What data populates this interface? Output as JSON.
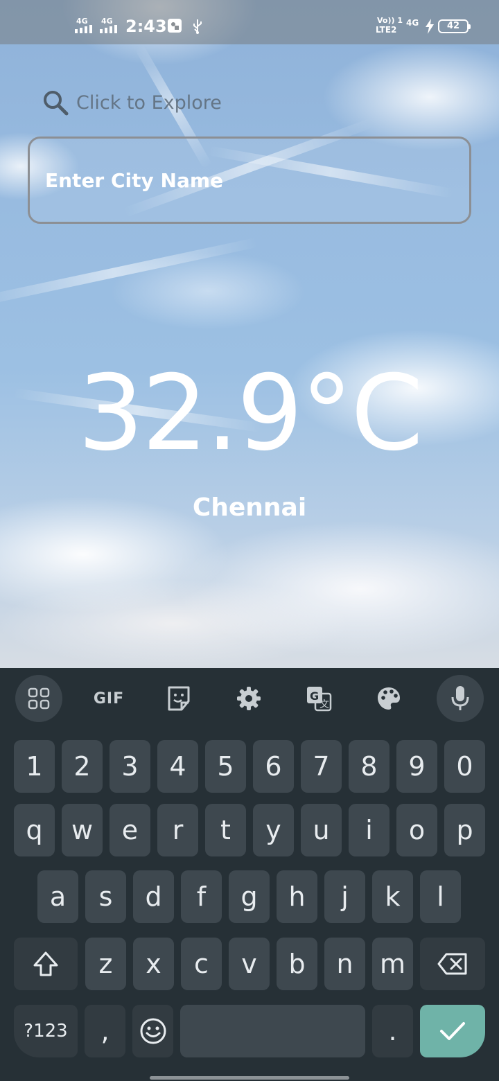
{
  "status_bar": {
    "signal1": "4G",
    "signal2": "4G",
    "time": "2:43",
    "volte": "Vo)) 1",
    "lte": "LTE2",
    "network": "4G",
    "battery": "42"
  },
  "search": {
    "hint_label": "Click to Explore",
    "placeholder": "Enter City Name"
  },
  "weather": {
    "temperature": "32.9°C",
    "city": "Chennai"
  },
  "keyboard": {
    "toolbar": {
      "gif_label": "GIF"
    },
    "number_row": [
      "1",
      "2",
      "3",
      "4",
      "5",
      "6",
      "7",
      "8",
      "9",
      "0"
    ],
    "row1": [
      "q",
      "w",
      "e",
      "r",
      "t",
      "y",
      "u",
      "i",
      "o",
      "p"
    ],
    "row2": [
      "a",
      "s",
      "d",
      "f",
      "g",
      "h",
      "j",
      "k",
      "l"
    ],
    "row3": [
      "z",
      "x",
      "c",
      "v",
      "b",
      "n",
      "m"
    ],
    "symbols_label": "?123",
    "comma": ",",
    "period": "."
  },
  "colors": {
    "keyboard_bg": "#263036",
    "key_bg": "#3e484f",
    "enter_key": "#6fb3a8"
  }
}
